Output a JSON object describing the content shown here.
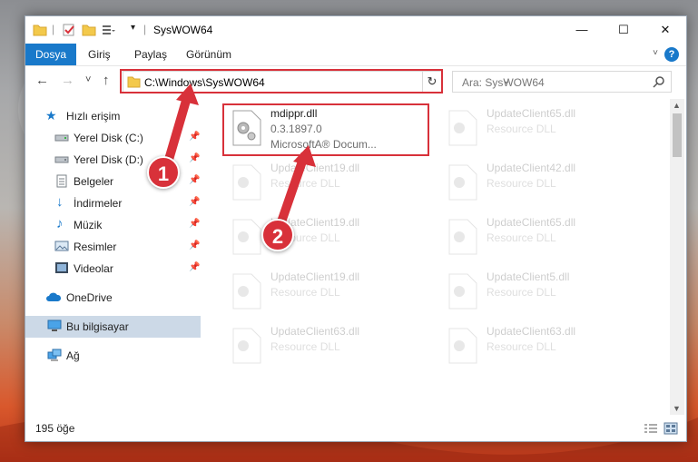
{
  "window": {
    "title": "SysWOW64",
    "controls": {
      "minimize": "—",
      "maximize": "☐",
      "close": "✕"
    }
  },
  "ribbon": {
    "tabs": [
      {
        "label": "Dosya",
        "active": true
      },
      {
        "label": "Giriş",
        "active": false
      },
      {
        "label": "Paylaş",
        "active": false
      },
      {
        "label": "Görünüm",
        "active": false
      }
    ],
    "help": "?"
  },
  "navigation": {
    "back": "←",
    "forward": "→",
    "recent": "˅",
    "up": "↑",
    "address": "C:\\Windows\\SysWOW64",
    "search_placeholder": "Ara: SysWOW64"
  },
  "sidebar": {
    "quick_access": "Hızlı erişim",
    "items": [
      {
        "label": "Yerel Disk (C:)",
        "icon": "drive-icon",
        "pinned": true
      },
      {
        "label": "Yerel Disk (D:)",
        "icon": "drive-icon",
        "pinned": true
      },
      {
        "label": "Belgeler",
        "icon": "documents-icon",
        "pinned": true
      },
      {
        "label": "İndirmeler",
        "icon": "downloads-icon",
        "pinned": true
      },
      {
        "label": "Müzik",
        "icon": "music-icon",
        "pinned": true
      },
      {
        "label": "Resimler",
        "icon": "pictures-icon",
        "pinned": true
      },
      {
        "label": "Videolar",
        "icon": "videos-icon",
        "pinned": true
      }
    ],
    "onedrive": "OneDrive",
    "this_pc": "Bu bilgisayar",
    "network": "Ağ"
  },
  "files": [
    {
      "name": "mdippr.dll",
      "line2": "0.3.1897.0",
      "line3": "MicrosoftA® Docum...",
      "highlighted": true
    },
    {
      "name": "UpdateClient65.dll",
      "line2": "Resource DLL",
      "line3": ""
    },
    {
      "name": "UpdateClient19.dll",
      "line2": "Resource DLL",
      "line3": ""
    },
    {
      "name": "UpdateClient42.dll",
      "line2": "Resource DLL",
      "line3": ""
    },
    {
      "name": "UpdateClient19.dll",
      "line2": "Resource DLL",
      "line3": ""
    },
    {
      "name": "UpdateClient65.dll",
      "line2": "Resource DLL",
      "line3": ""
    },
    {
      "name": "UpdateClient19.dll",
      "line2": "Resource DLL",
      "line3": ""
    },
    {
      "name": "UpdateClient5.dll",
      "line2": "Resource DLL",
      "line3": ""
    },
    {
      "name": "UpdateClient63.dll",
      "line2": "Resource DLL",
      "line3": ""
    },
    {
      "name": "UpdateClient63.dll",
      "line2": "Resource DLL",
      "line3": ""
    }
  ],
  "status": {
    "count": "195 öğe"
  },
  "annotations": [
    {
      "label": "1"
    },
    {
      "label": "2"
    }
  ],
  "colors": {
    "accent": "#1979ca",
    "highlight": "#d8313a",
    "selected": "#ccd9e7"
  }
}
